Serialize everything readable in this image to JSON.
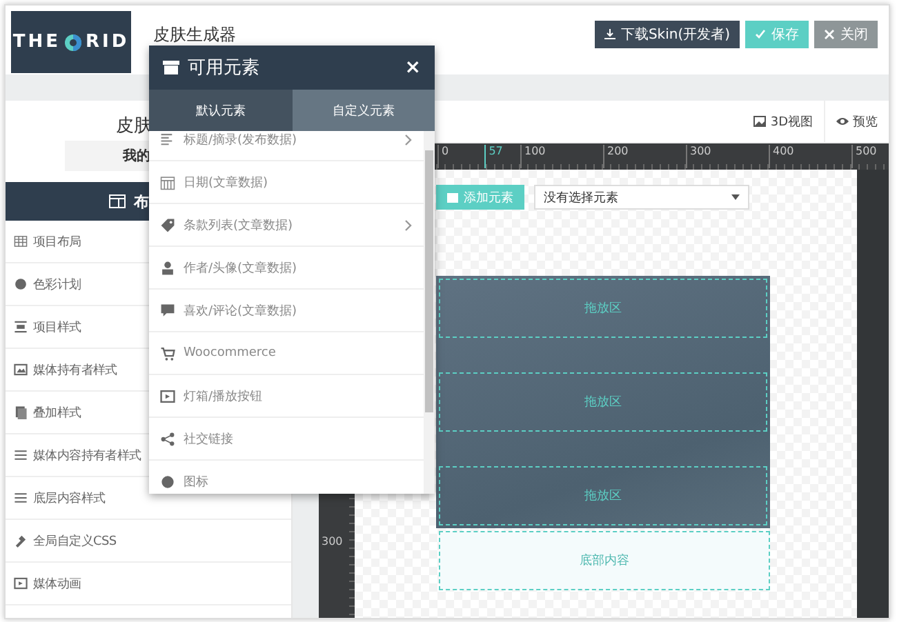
{
  "header": {
    "logo": {
      "left": "THE",
      "right": "RID"
    },
    "title": "皮肤生成器",
    "buttons": [
      {
        "kind": "download",
        "label": "下载Skin(开发者)"
      },
      {
        "kind": "save",
        "label": "保存"
      },
      {
        "kind": "close",
        "label": "关闭"
      }
    ]
  },
  "left_panel": {
    "title": "皮肤",
    "subtitle": "我的",
    "section_header": "布",
    "items": [
      {
        "label": "项目布局"
      },
      {
        "label": "色彩计划"
      },
      {
        "label": "项目样式"
      },
      {
        "label": "媒体持有者样式"
      },
      {
        "label": "叠加样式"
      },
      {
        "label": "媒体内容持有者样式"
      },
      {
        "label": "底层内容样式"
      },
      {
        "label": "全局自定义CSS"
      },
      {
        "label": "媒体动画"
      }
    ]
  },
  "toolbar": {
    "buttons": [
      {
        "kind": "view3d",
        "label": "3D视图"
      },
      {
        "kind": "preview",
        "label": "预览"
      }
    ]
  },
  "ruler": {
    "top_labels": [
      {
        "label": "0",
        "marked": false
      },
      {
        "label": "57",
        "marked": true
      },
      {
        "label": "100",
        "marked": false
      },
      {
        "label": "200",
        "marked": false
      },
      {
        "label": "300",
        "marked": false
      },
      {
        "label": "400",
        "marked": false
      },
      {
        "label": "500",
        "marked": false
      }
    ],
    "side_labels": [
      "300"
    ]
  },
  "canvas": {
    "add_button": "添加元素",
    "select": {
      "value": "没有选择元素"
    },
    "zones": [
      {
        "kind": "drop",
        "label": "拖放区"
      },
      {
        "kind": "drop",
        "label": "拖放区"
      },
      {
        "kind": "drop",
        "label": "拖放区"
      },
      {
        "kind": "footer",
        "label": "底部内容"
      }
    ]
  },
  "popup": {
    "title": "可用元素",
    "close": "×",
    "tabs": [
      {
        "label": "默认元素",
        "selected": true
      },
      {
        "label": "自定义元素",
        "selected": false
      }
    ],
    "items": [
      {
        "label": "标题/摘录(发布数据)",
        "has_submenu": true
      },
      {
        "label": "日期(文章数据)",
        "has_submenu": false
      },
      {
        "label": "条款列表(文章数据)",
        "has_submenu": true
      },
      {
        "label": "作者/头像(文章数据)",
        "has_submenu": false
      },
      {
        "label": "喜欢/评论(文章数据)",
        "has_submenu": false
      },
      {
        "label": "Woocommerce",
        "has_submenu": false
      },
      {
        "label": "灯箱/播放按钮",
        "has_submenu": false
      },
      {
        "label": "社交链接",
        "has_submenu": false
      },
      {
        "label": "图标",
        "has_submenu": false
      }
    ]
  }
}
